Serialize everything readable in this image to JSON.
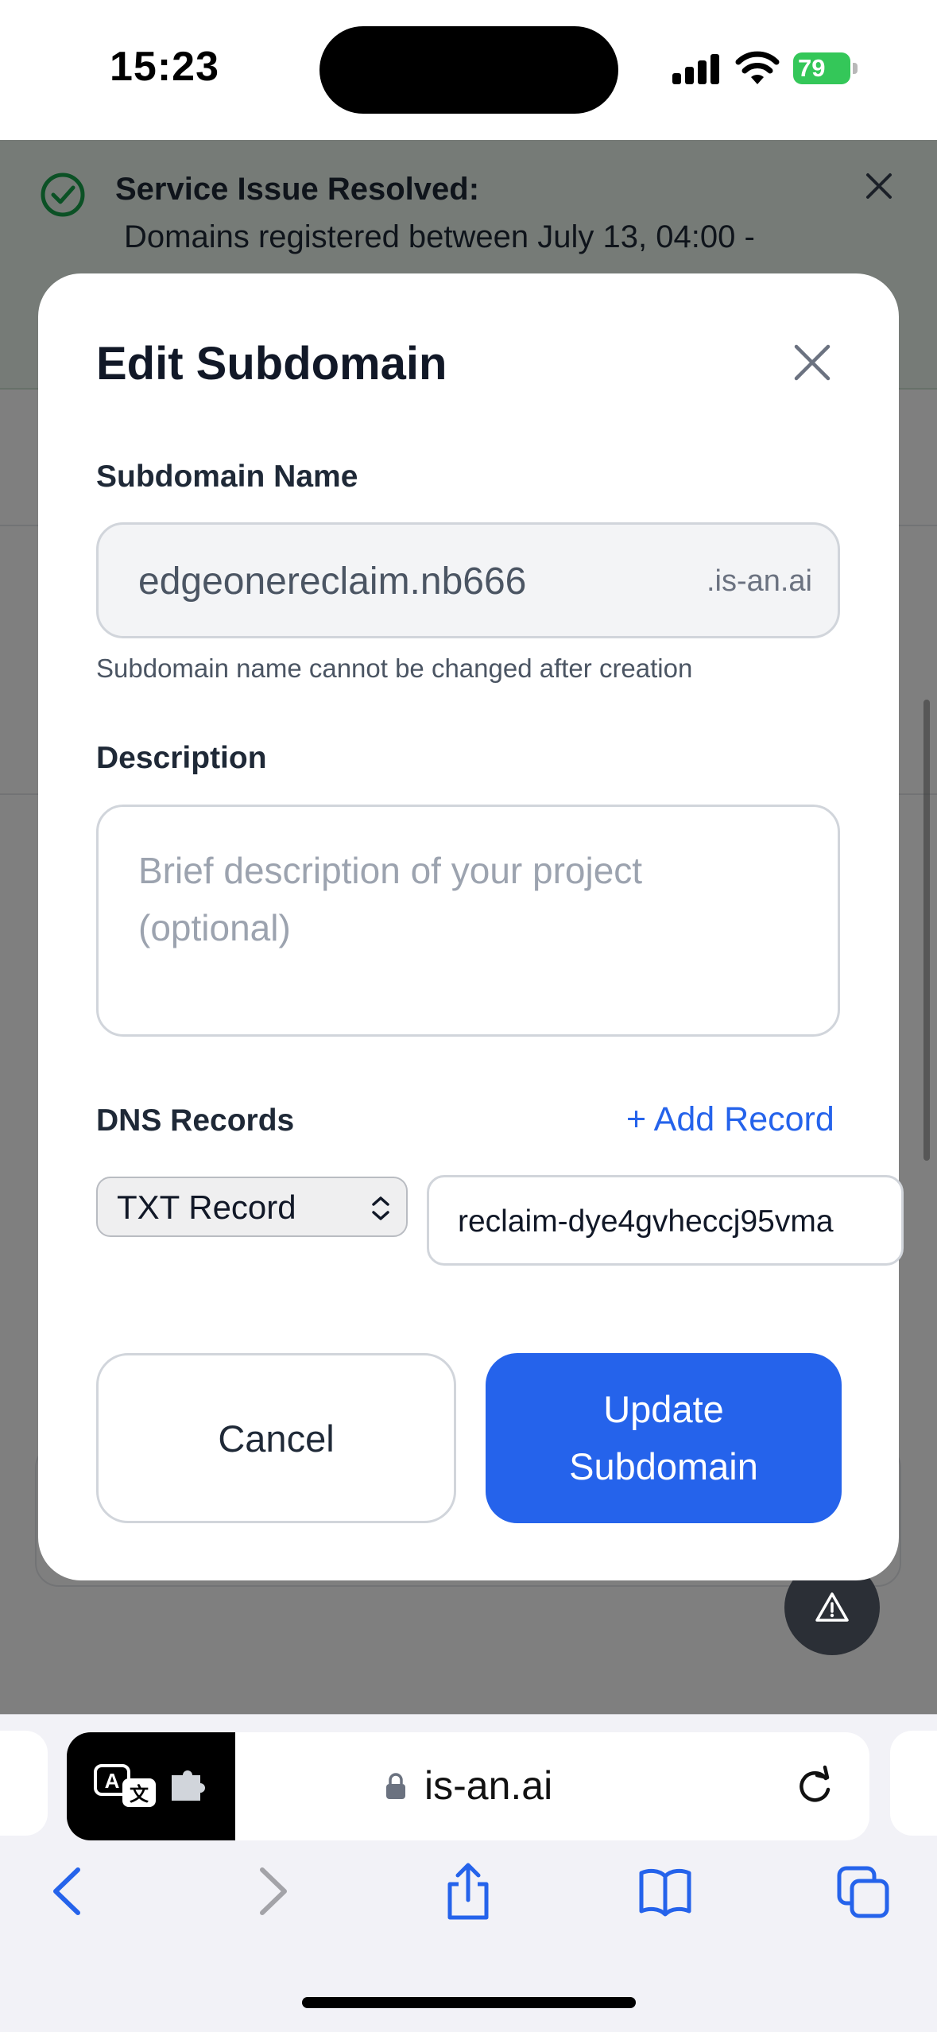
{
  "status_bar": {
    "time": "15:23",
    "battery": "79"
  },
  "banner": {
    "title": "Service Issue Resolved:",
    "text": "Domains registered between July 13, 04:00 -"
  },
  "modal": {
    "title": "Edit Subdomain",
    "subdomain_label": "Subdomain Name",
    "subdomain_value": "edgeonereclaim.nb666",
    "subdomain_suffix": ".is-an.ai",
    "subdomain_help": "Subdomain name cannot be changed after creation",
    "description_label": "Description",
    "description_placeholder": "Brief description of your project (optional)",
    "dns_label": "DNS Records",
    "add_record": "+ Add Record",
    "record_type": "TXT Record",
    "record_value": "reclaim-dye4gvheccj95vma",
    "cancel": "Cancel",
    "update": "Update Subdomain"
  },
  "browser": {
    "url": "is-an.ai"
  },
  "colors": {
    "primary": "#2563eb",
    "success": "#16a34a",
    "battery": "#34c759"
  }
}
